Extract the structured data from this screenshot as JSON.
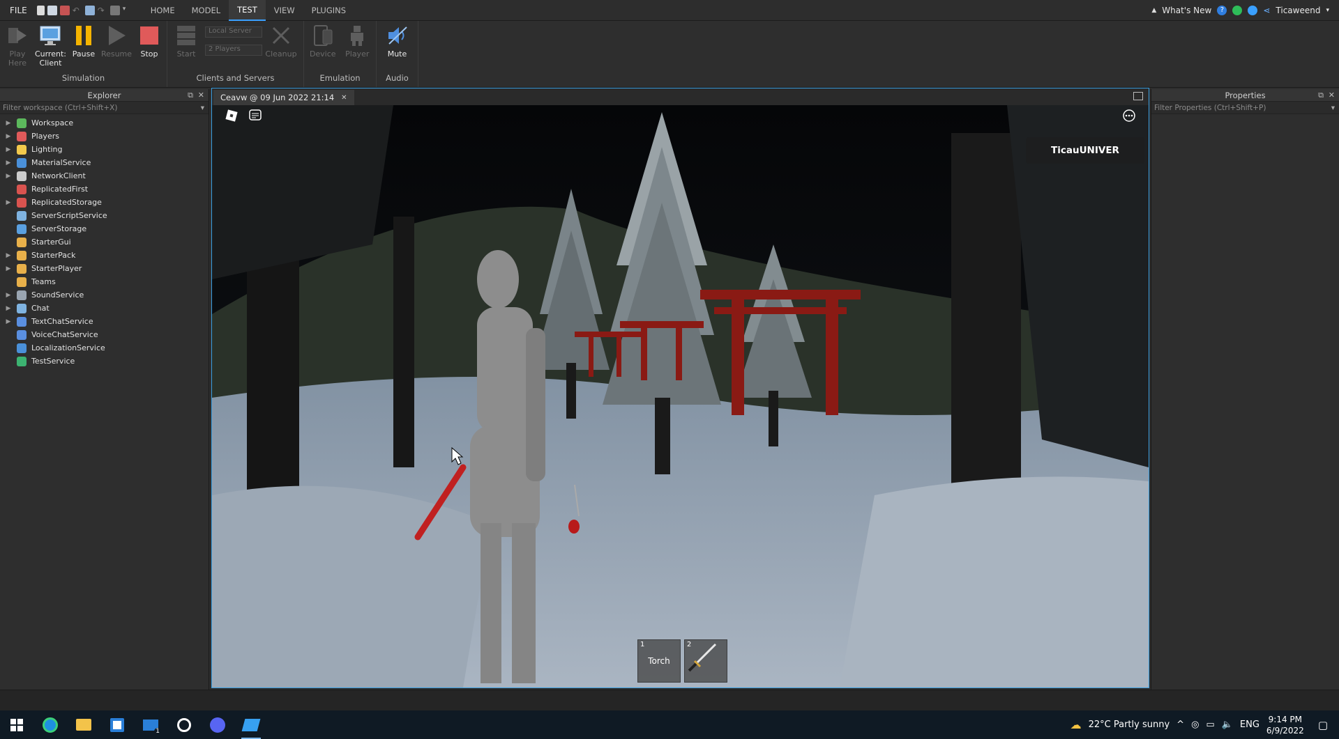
{
  "menu": {
    "file_label": "FILE",
    "tabs": [
      {
        "label": "HOME"
      },
      {
        "label": "MODEL"
      },
      {
        "label": "TEST"
      },
      {
        "label": "VIEW"
      },
      {
        "label": "PLUGINS"
      }
    ],
    "active_tab": "TEST",
    "whats_new": "What's New",
    "username": "Ticaweend"
  },
  "ribbon": {
    "simulation": {
      "label": "Simulation",
      "play_here": "Play\nHere",
      "current_client": "Current:\nClient",
      "pause": "Pause",
      "resume": "Resume",
      "stop": "Stop"
    },
    "clients_servers": {
      "label": "Clients and Servers",
      "start": "Start",
      "server_select": "Local Server",
      "players_select": "2 Players",
      "cleanup": "Cleanup"
    },
    "emulation": {
      "label": "Emulation",
      "device": "Device",
      "player": "Player"
    },
    "audio": {
      "label": "Audio",
      "mute": "Mute"
    }
  },
  "explorer": {
    "title": "Explorer",
    "filter_placeholder": "Filter workspace (Ctrl+Shift+X)",
    "items": [
      {
        "label": "Workspace",
        "expandable": true,
        "icon": "globe-icon",
        "color": "#5cb85c"
      },
      {
        "label": "Players",
        "expandable": true,
        "icon": "players-icon",
        "color": "#e05a5a"
      },
      {
        "label": "Lighting",
        "expandable": true,
        "icon": "bulb-icon",
        "color": "#f2c94c"
      },
      {
        "label": "MaterialService",
        "expandable": true,
        "icon": "material-icon",
        "color": "#4a90d9"
      },
      {
        "label": "NetworkClient",
        "expandable": true,
        "icon": "network-icon",
        "color": "#cccccc"
      },
      {
        "label": "ReplicatedFirst",
        "expandable": false,
        "icon": "replicated-icon",
        "color": "#d9534f"
      },
      {
        "label": "ReplicatedStorage",
        "expandable": true,
        "icon": "replicated-storage-icon",
        "color": "#d9534f"
      },
      {
        "label": "ServerScriptService",
        "expandable": false,
        "icon": "script-service-icon",
        "color": "#7fb3e0"
      },
      {
        "label": "ServerStorage",
        "expandable": false,
        "icon": "server-storage-icon",
        "color": "#5aa0e0"
      },
      {
        "label": "StarterGui",
        "expandable": false,
        "icon": "gui-icon",
        "color": "#e8b04a"
      },
      {
        "label": "StarterPack",
        "expandable": true,
        "icon": "pack-icon",
        "color": "#e8b04a"
      },
      {
        "label": "StarterPlayer",
        "expandable": true,
        "icon": "starter-player-icon",
        "color": "#e8b04a"
      },
      {
        "label": "Teams",
        "expandable": false,
        "icon": "teams-icon",
        "color": "#e8b04a"
      },
      {
        "label": "SoundService",
        "expandable": true,
        "icon": "sound-icon",
        "color": "#9aa5b1"
      },
      {
        "label": "Chat",
        "expandable": true,
        "icon": "chat-icon",
        "color": "#7fb3e0"
      },
      {
        "label": "TextChatService",
        "expandable": true,
        "icon": "text-chat-icon",
        "color": "#5a8fe0"
      },
      {
        "label": "VoiceChatService",
        "expandable": false,
        "icon": "voice-chat-icon",
        "color": "#5a8fe0"
      },
      {
        "label": "LocalizationService",
        "expandable": false,
        "icon": "localization-icon",
        "color": "#4a90d9"
      },
      {
        "label": "TestService",
        "expandable": false,
        "icon": "test-icon",
        "color": "#3cb371"
      }
    ]
  },
  "properties": {
    "title": "Properties",
    "filter_placeholder": "Filter Properties (Ctrl+Shift+P)"
  },
  "document": {
    "tab_title": "Ceavw @ 09 Jun 2022 21:14"
  },
  "game": {
    "player_name": "TicauUNIVER",
    "hotbar": [
      {
        "slot": "1",
        "label": "Torch"
      },
      {
        "slot": "2",
        "label": ""
      }
    ]
  },
  "taskbar": {
    "weather": "22°C  Partly sunny",
    "language": "ENG",
    "time": "9:14 PM",
    "date": "6/9/2022",
    "mail_badge": "1"
  }
}
